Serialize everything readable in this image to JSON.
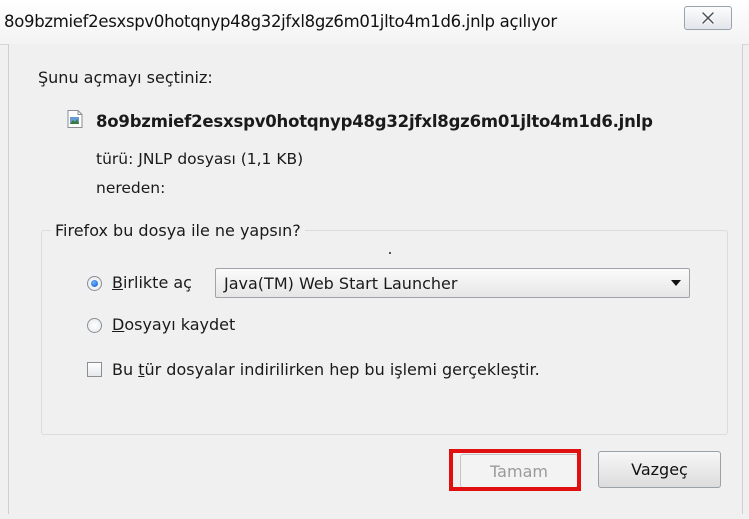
{
  "window": {
    "title": "8o9bzmief2esxspv0hotqnyp48g32jfxl8gz6m01jlto4m1d6.jnlp açılıyor"
  },
  "dialog": {
    "intro": "Şunu açmayı seçtiniz:",
    "file_name": "8o9bzmief2esxspv0hotqnyp48g32jfxl8gz6m01jlto4m1d6.jnlp",
    "type_line": "türü: JNLP dosyası (1,1 KB)",
    "from_line": "nereden:",
    "group_legend": "Firefox bu dosya ile ne yapsın?",
    "open_with": {
      "label_access": "B",
      "label_rest": "irlikte aç",
      "selected": true,
      "app": "Java(TM) Web Start Launcher"
    },
    "save_file": {
      "label_access": "D",
      "label_rest": "osyayı kaydet",
      "selected": false
    },
    "remember": {
      "label_pre": "Bu ",
      "label_access": "t",
      "label_rest": "ür dosyalar indirilirken hep bu işlemi gerçekleştir.",
      "checked": false
    }
  },
  "buttons": {
    "ok": "Tamam",
    "cancel": "Vazgeç"
  },
  "colors": {
    "highlight": "#e01010",
    "radio_selected": "#0b56c4"
  }
}
